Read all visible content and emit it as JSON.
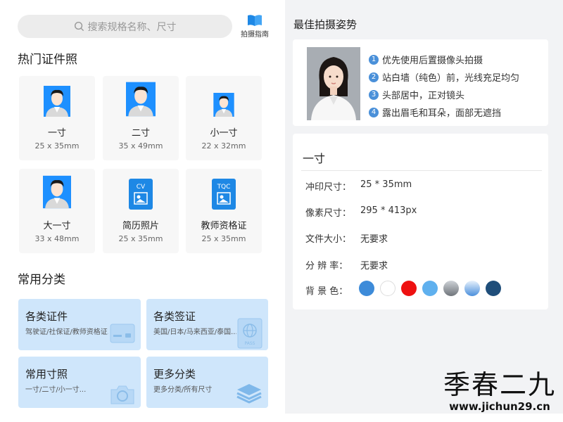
{
  "search": {
    "placeholder": "搜索规格名称、尺寸"
  },
  "guide": {
    "label": "拍摄指南"
  },
  "hot": {
    "title": "热门证件照",
    "items": [
      {
        "name": "一寸",
        "size": "25 x 35mm",
        "icon": "person-avatar-icon"
      },
      {
        "name": "二寸",
        "size": "35 x 49mm",
        "icon": "person-avatar-icon"
      },
      {
        "name": "小一寸",
        "size": "22 x 32mm",
        "icon": "person-avatar-icon"
      },
      {
        "name": "大一寸",
        "size": "33 x 48mm",
        "icon": "person-avatar-icon"
      },
      {
        "name": "简历照片",
        "size": "25 x 35mm",
        "icon": "cv-document-icon",
        "badge": "CV"
      },
      {
        "name": "教师资格证",
        "size": "25 x 35mm",
        "icon": "tqc-document-icon",
        "badge": "TQC"
      }
    ]
  },
  "categories": {
    "title": "常用分类",
    "items": [
      {
        "title": "各类证件",
        "sub": "驾驶证/社保证/教师资格证...",
        "icon": "id-card-icon"
      },
      {
        "title": "各类签证",
        "sub": "美国/日本/马来西亚/泰国...",
        "icon": "passport-icon",
        "badge": "PASS"
      },
      {
        "title": "常用寸照",
        "sub": "一寸/二寸/小一寸...",
        "icon": "camera-icon"
      },
      {
        "title": "更多分类",
        "sub": "更多分类/所有尺寸",
        "icon": "layers-icon"
      }
    ]
  },
  "pose": {
    "title": "最佳拍摄姿势",
    "tips": [
      {
        "num": "1",
        "text": "优先使用后置摄像头拍摄"
      },
      {
        "num": "2",
        "text": "站白墙（纯色）前，光线充足均匀"
      },
      {
        "num": "3",
        "text": "头部居中，正对镜头"
      },
      {
        "num": "4",
        "text": "露出眉毛和耳朵，面部无遮挡"
      }
    ]
  },
  "spec": {
    "name": "一寸",
    "rows": [
      {
        "label": "冲印尺寸：",
        "value": "25 * 35mm"
      },
      {
        "label": "像素尺寸：",
        "value": "295 * 413px"
      },
      {
        "label": "文件大小：",
        "value": "无要求"
      },
      {
        "label": "分 辨 率：",
        "value": "无要求"
      }
    ],
    "bg_label": "背 景 色：",
    "bg_colors": [
      "#3d8bd9",
      "#ffffff",
      "#ee1111",
      "#5fb0ee",
      "gradient-gray",
      "gradient-blue",
      "#1f4e7a"
    ]
  },
  "watermark": {
    "big": "季春二九",
    "small": "www.jichun29.cn"
  }
}
